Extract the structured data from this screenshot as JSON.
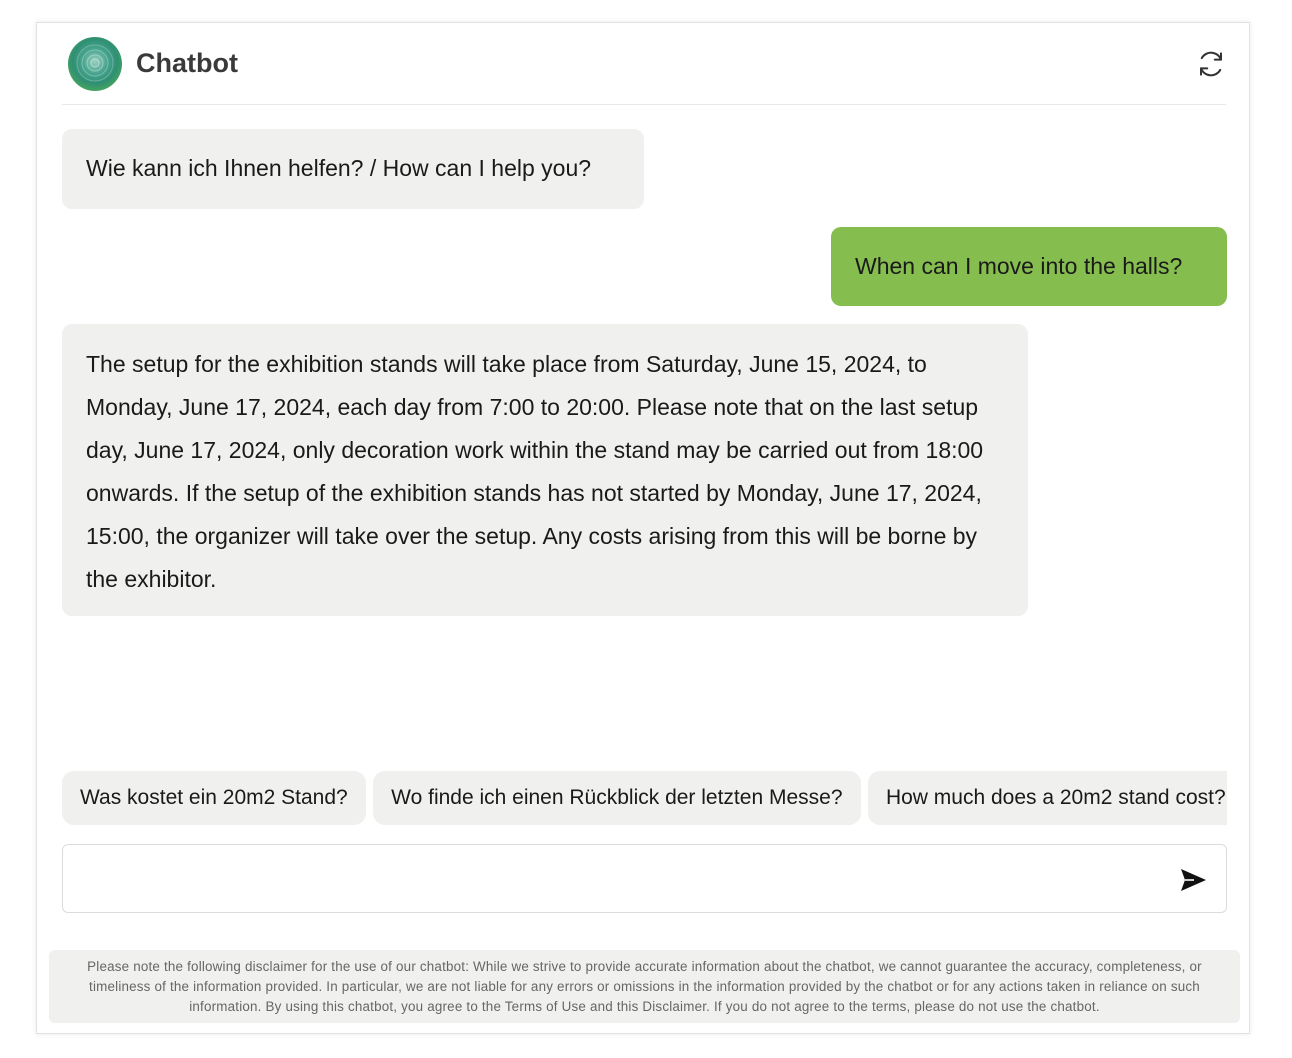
{
  "header": {
    "title": "Chatbot",
    "avatar_icon": "chatbot-logo",
    "refresh_icon": "refresh-icon"
  },
  "messages": [
    {
      "role": "bot",
      "text": "Wie kann ich Ihnen helfen? / How can I help you?"
    },
    {
      "role": "user",
      "text": "When can I move into the halls?"
    },
    {
      "role": "bot",
      "text": "The setup for the exhibition stands will take place from Saturday, June 15, 2024, to Monday, June 17, 2024, each day from 7:00 to 20:00. Please note that on the last setup day, June 17, 2024, only decoration work within the stand may be carried out from 18:00 onwards. If the setup of the exhibition stands has not started by Monday, June 17, 2024, 15:00, the organizer will take over the setup. Any costs arising from this will be borne by the exhibitor."
    }
  ],
  "suggestions": [
    "Was kostet ein 20m2 Stand?",
    "Wo finde ich einen Rückblick der letzten Messe?",
    "How much does a 20m2 stand cost?"
  ],
  "input": {
    "value": "",
    "placeholder": "",
    "send_icon": "send-icon"
  },
  "disclaimer": "Please note the following disclaimer for the use of our chatbot: While we strive to provide accurate information about the chatbot, we cannot guarantee the accuracy, completeness, or timeliness of the information provided. In particular, we are not liable for any errors or omissions in the information provided by the chatbot or for any actions taken in reliance on such information. By using this chatbot, you agree to the Terms of Use and this Disclaimer. If you do not agree to the terms, please do not use the chatbot.",
  "colors": {
    "user_bubble": "#86bd4f",
    "bot_bubble": "#f0f0ef",
    "disclaimer_bg": "#f0f0ef"
  }
}
